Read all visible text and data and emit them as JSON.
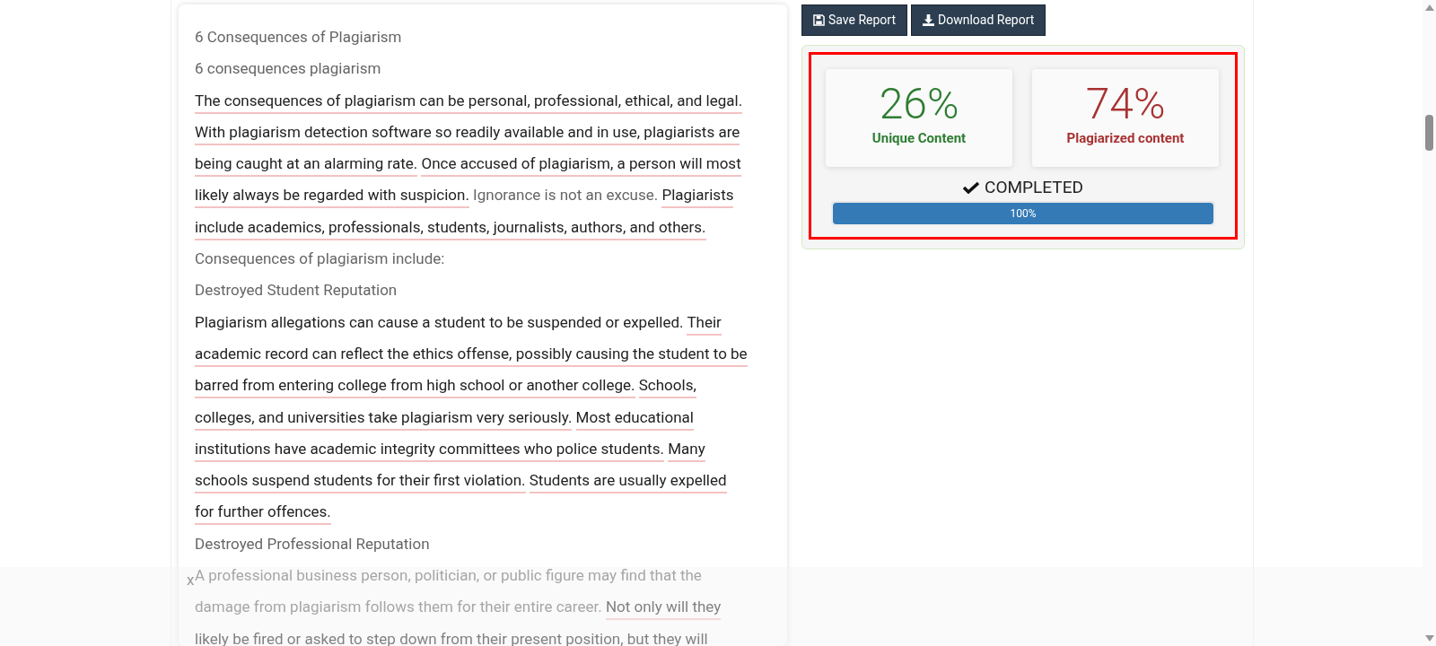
{
  "article": {
    "lines": [
      [
        {
          "kind": "muted",
          "text": "6 Consequences of Plagiarism"
        }
      ],
      [
        {
          "kind": "muted",
          "text": "6 consequences plagiarism"
        }
      ],
      [
        {
          "kind": "matched",
          "text": "The consequences of plagiarism can be personal, professional, ethical, and legal."
        }
      ],
      [
        {
          "kind": "matched",
          "text": "With plagiarism detection software so readily available and in use, plagiarists are"
        }
      ],
      [
        {
          "kind": "matched",
          "text": "being caught at an alarming rate."
        },
        {
          "kind": "matched",
          "text": "Once accused of plagiarism, a person will most"
        }
      ],
      [
        {
          "kind": "matched",
          "text": "likely always be regarded with suspicion."
        },
        {
          "kind": "muted",
          "text": "Ignorance is not an excuse."
        },
        {
          "kind": "matched",
          "text": "Plagiarists"
        }
      ],
      [
        {
          "kind": "matched",
          "text": "include academics, professionals, students, journalists, authors, and others."
        }
      ],
      [
        {
          "kind": "muted",
          "text": "Consequences of plagiarism include:"
        }
      ],
      [
        {
          "kind": "muted",
          "text": "Destroyed Student Reputation"
        }
      ],
      [
        {
          "kind": "plain",
          "text": "Plagiarism allegations can cause a student to be suspended or expelled."
        },
        {
          "kind": "matched",
          "text": "Their"
        }
      ],
      [
        {
          "kind": "matched",
          "text": "academic record can reflect the ethics offense, possibly causing the student to be"
        }
      ],
      [
        {
          "kind": "matched",
          "text": "barred from entering college from high school or another college."
        },
        {
          "kind": "matched",
          "text": "Schools,"
        }
      ],
      [
        {
          "kind": "matched",
          "text": "colleges, and universities take plagiarism very seriously."
        },
        {
          "kind": "matched",
          "text": "Most educational"
        }
      ],
      [
        {
          "kind": "matched",
          "text": "institutions have academic integrity committees who police students."
        },
        {
          "kind": "matched",
          "text": "Many"
        }
      ],
      [
        {
          "kind": "matched",
          "text": "schools suspend students for their first violation."
        },
        {
          "kind": "matched",
          "text": "Students are usually expelled"
        }
      ],
      [
        {
          "kind": "matched",
          "text": "for further offences."
        }
      ],
      [
        {
          "kind": "muted",
          "text": "Destroyed Professional Reputation"
        }
      ],
      [
        {
          "kind": "muted",
          "text": "A professional business person, politician, or public figure may find that the"
        }
      ],
      [
        {
          "kind": "muted",
          "text": "damage from plagiarism follows them for their entire career."
        },
        {
          "kind": "matched",
          "text": "Not only will they"
        }
      ],
      [
        {
          "kind": "matched",
          "text": "likely be fired or asked to step down from their present position, but they will"
        }
      ]
    ]
  },
  "buttons": [
    {
      "kind": "save",
      "label": "Save Report"
    },
    {
      "kind": "download",
      "label": "Download Report"
    }
  ],
  "stats": [
    {
      "value": "26%",
      "label": "Unique Content",
      "color": "#2e7d32"
    },
    {
      "value": "74%",
      "label": "Plagiarized content",
      "color": "#a83232"
    }
  ],
  "status": {
    "text": "COMPLETED",
    "done": true
  },
  "progress": {
    "level": 1,
    "label": "100%"
  },
  "overlay": {
    "close": "x"
  }
}
